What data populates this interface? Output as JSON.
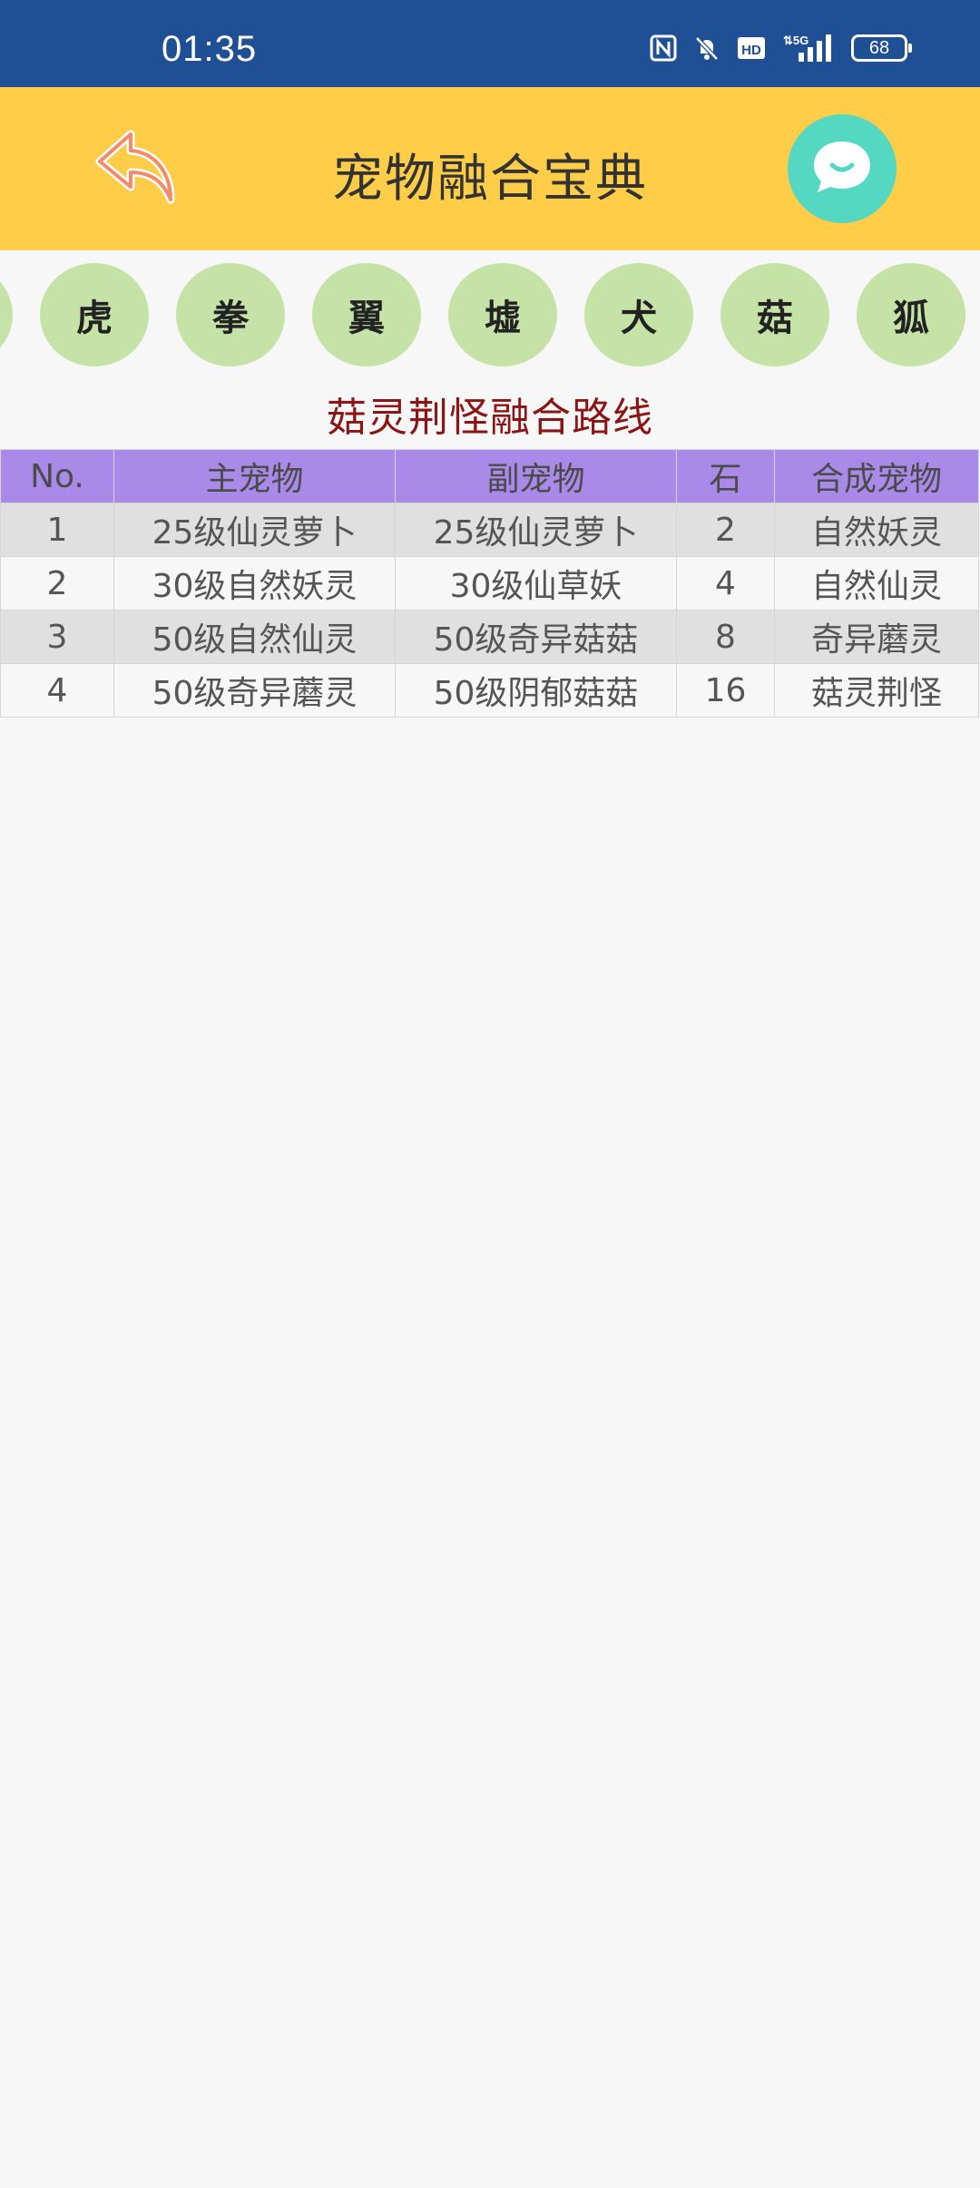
{
  "status_bar": {
    "time": "01:35",
    "battery": "68",
    "icons": [
      "nfc-icon",
      "bell-muted-icon",
      "hd-icon",
      "signal-5g-icon",
      "battery-icon"
    ]
  },
  "header": {
    "title": "宠物融合宝典",
    "back_icon": "back-arrow-icon",
    "chat_icon": "chat-bubble-icon",
    "background_color": "#ffcd47"
  },
  "categories": [
    "虎",
    "拳",
    "翼",
    "墟",
    "犬",
    "菇",
    "狐"
  ],
  "route": {
    "title": "菇灵荆怪融合路线"
  },
  "table": {
    "headers": [
      "No.",
      "主宠物",
      "副宠物",
      "石",
      "合成宠物"
    ],
    "rows": [
      [
        "1",
        "25级仙灵萝卜",
        "25级仙灵萝卜",
        "2",
        "自然妖灵"
      ],
      [
        "2",
        "30级自然妖灵",
        "30级仙草妖",
        "4",
        "自然仙灵"
      ],
      [
        "3",
        "50级自然仙灵",
        "50级奇异菇菇",
        "8",
        "奇异蘑灵"
      ],
      [
        "4",
        "50级奇异蘑灵",
        "50级阴郁菇菇",
        "16",
        "菇灵荆怪"
      ]
    ],
    "header_color": "#a98ae9"
  }
}
